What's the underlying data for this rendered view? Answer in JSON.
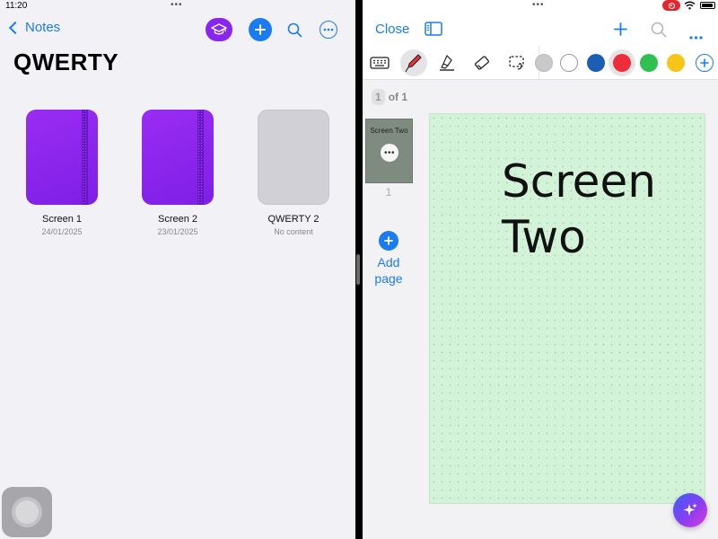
{
  "status": {
    "time": "11:20"
  },
  "left": {
    "back_label": "Notes",
    "title": "QWERTY",
    "notebooks": [
      {
        "name": "Screen 1",
        "date": "24/01/2025",
        "cover": "purple"
      },
      {
        "name": "Screen 2",
        "date": "23/01/2025",
        "cover": "purple"
      },
      {
        "name": "QWERTY 2",
        "date": "No content",
        "cover": "gray"
      }
    ],
    "icons": [
      "graduation-cap-icon",
      "plus-icon",
      "search-icon",
      "more-icon"
    ]
  },
  "right": {
    "close_label": "Close",
    "toolbar_tools": [
      "keyboard-icon",
      "pen-icon",
      "highlighter-icon",
      "eraser-icon",
      "lasso-icon"
    ],
    "colors": [
      "#c9c9cc",
      "#ffffff",
      "#1a5fb4",
      "#ef2c3a",
      "#2fc150",
      "#f5c518"
    ],
    "selected_color": "#ef2c3a",
    "page_indicator": {
      "current": "1",
      "of_label": "of 1"
    },
    "thumbnail": {
      "text": "Screen Two",
      "number": "1"
    },
    "add_page_label": "Add page",
    "note_text": "Screen\nTwo",
    "page_background": "#d3f3d8"
  },
  "colors": {
    "accent": "#1a7cf0",
    "purple": "#8a25ee",
    "recording": "#e5262f"
  }
}
